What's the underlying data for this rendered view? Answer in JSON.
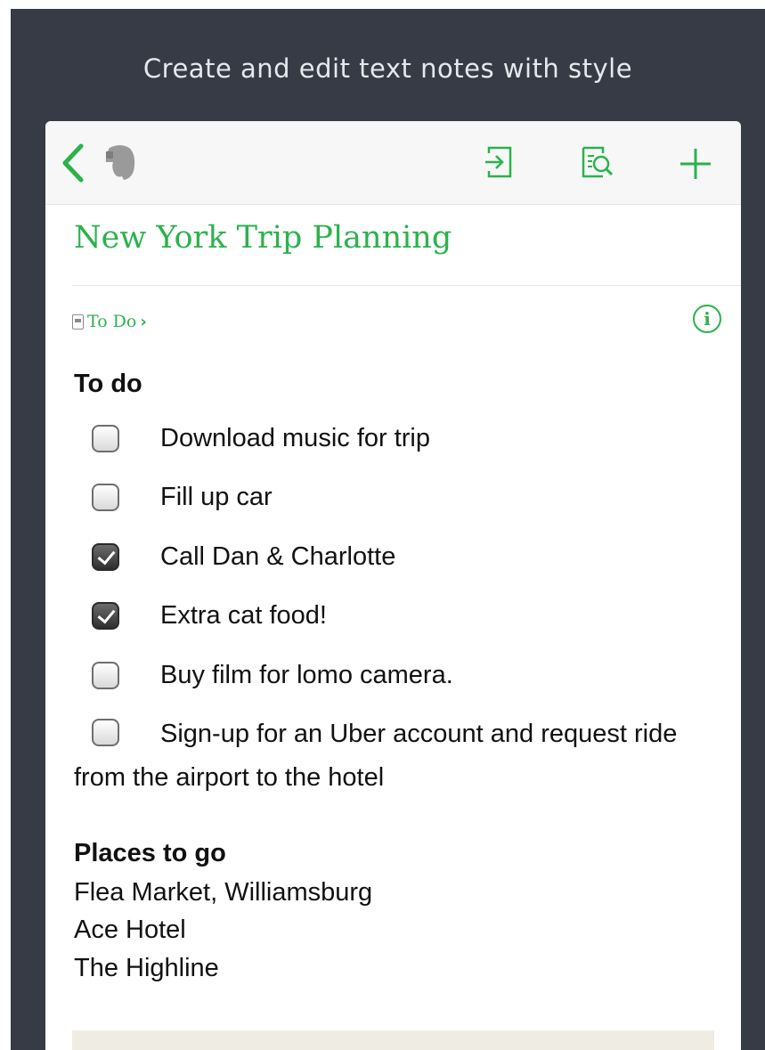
{
  "caption": "Create and edit text notes with style",
  "toolbar": {
    "back_icon": "chevron-left-icon",
    "logo_icon": "evernote-elephant-icon",
    "actions": [
      "share-icon",
      "note-search-icon",
      "plus-icon"
    ],
    "accent_color": "#2bb24c"
  },
  "note": {
    "title": "New York Trip Planning",
    "notebook": "To Do",
    "info_icon": "i",
    "todo_heading": "To do",
    "todos": [
      {
        "label": "Download music for trip",
        "checked": false
      },
      {
        "label": "Fill up car",
        "checked": false
      },
      {
        "label": "Call Dan & Charlotte",
        "checked": true
      },
      {
        "label": "Extra cat food!",
        "checked": true
      },
      {
        "label": "Buy film for lomo camera.",
        "checked": false
      },
      {
        "label": "Sign-up for an Uber account and request ride from the airport to the hotel",
        "checked": false
      }
    ],
    "places_heading": "Places to go",
    "places": [
      "Flea Market, Williamsburg",
      "Ace Hotel",
      "The Highline"
    ]
  }
}
